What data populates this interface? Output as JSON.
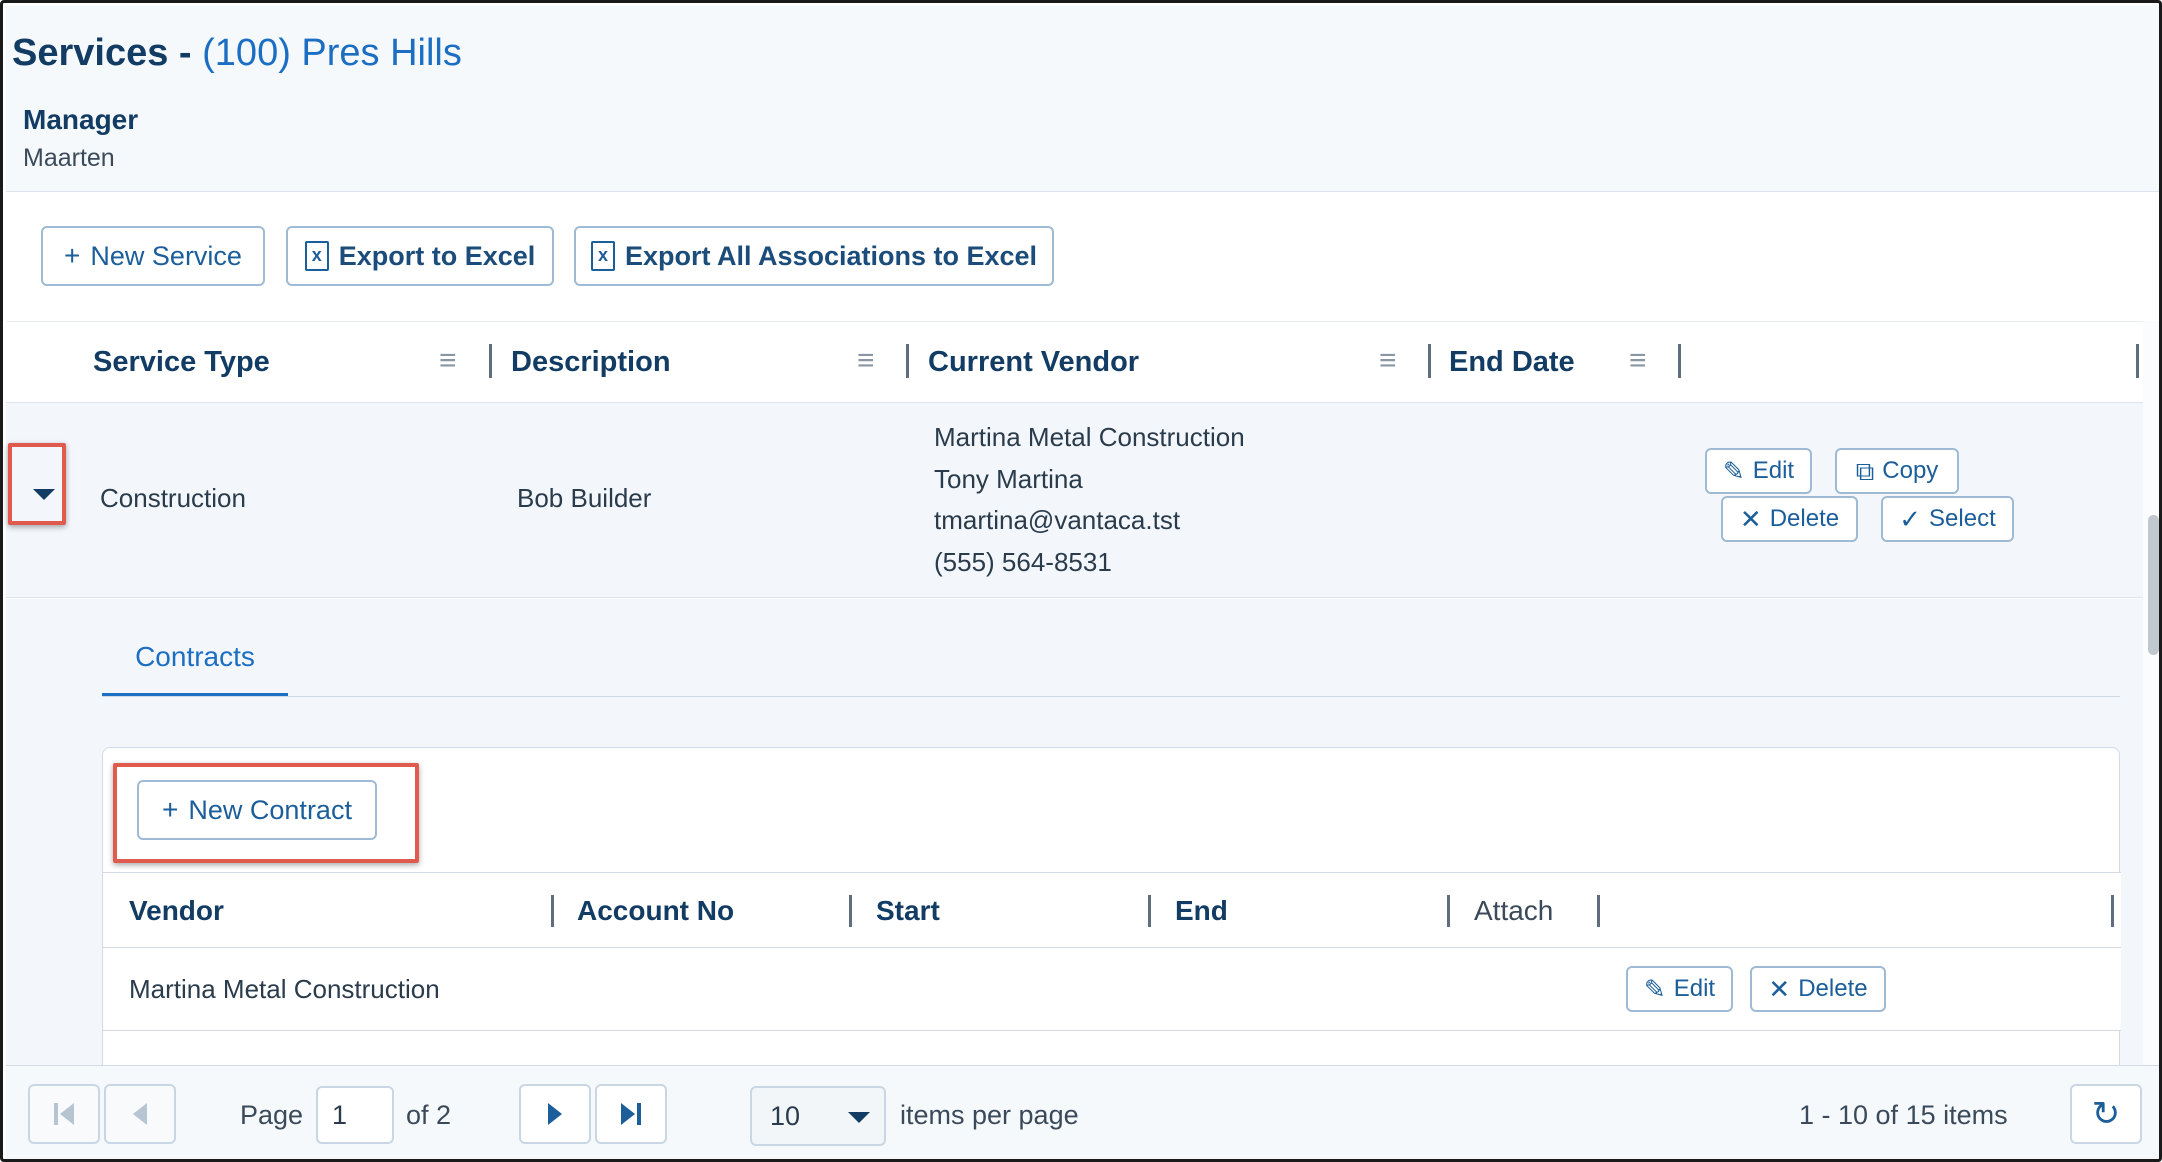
{
  "header": {
    "title": "Services -",
    "association": "(100) Pres Hills",
    "manager_label": "Manager",
    "manager_name": "Maarten"
  },
  "toolbar": {
    "new_service": "New Service",
    "export_excel": "Export to Excel",
    "export_all": "Export All Associations to Excel"
  },
  "grid": {
    "columns": [
      "Service Type",
      "Description",
      "Current Vendor",
      "End Date"
    ],
    "row": {
      "service_type": "Construction",
      "description": "Bob Builder",
      "vendor_name": "Martina Metal Construction",
      "vendor_contact": "Tony Martina",
      "vendor_email": "tmartina@vantaca.tst",
      "vendor_phone": "(555) 564-8531",
      "actions": {
        "edit": "Edit",
        "copy": "Copy",
        "delete": "Delete",
        "select": "Select"
      }
    }
  },
  "detail": {
    "tab": "Contracts",
    "new_contract": "New Contract",
    "columns": [
      "Vendor",
      "Account No",
      "Start",
      "End",
      "Attach"
    ],
    "rows": [
      {
        "vendor": "Martina Metal Construction",
        "edit": "Edit",
        "delete": "Delete"
      }
    ]
  },
  "pager": {
    "page_label": "Page",
    "page": "1",
    "of": "of 2",
    "page_size": "10",
    "items_per_page": "items per page",
    "summary": "1 - 10 of 15 items"
  },
  "colors": {
    "accent": "#1b6ec2",
    "heading": "#123c63",
    "highlight": "#e05a4e"
  }
}
